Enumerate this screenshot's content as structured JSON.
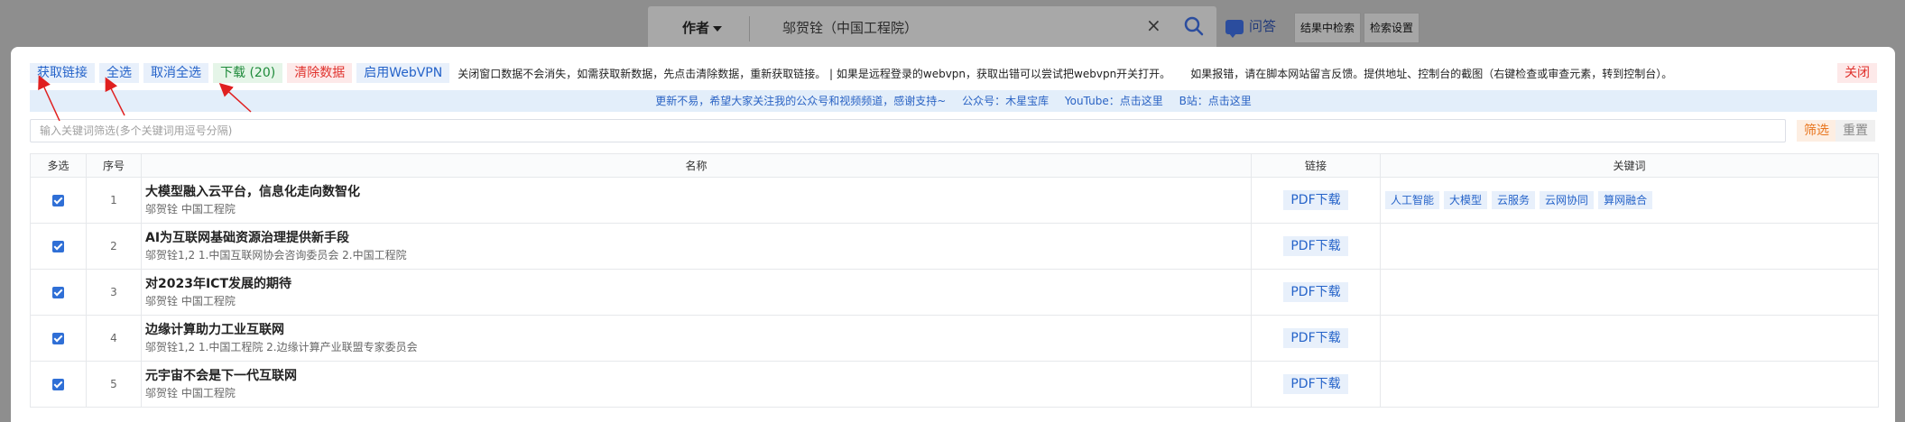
{
  "background": {
    "search_field_label": "作者",
    "search_query": "邬贺铨（中国工程院）",
    "qa_label": "问答",
    "buttons": [
      "结果中检索",
      "检索设置"
    ],
    "clear_glyph": "×"
  },
  "toolbar": {
    "get_links": "获取链接",
    "select_all": "全选",
    "deselect_all": "取消全选",
    "download": "下载 (20)",
    "clear_data": "清除数据",
    "enable_webvpn": "启用WebVPN",
    "note1": "关闭窗口数据不会消失，如需获取新数据，先点击清除数据，重新获取链接。 | 如果是远程登录的webvpn，获取出错可以尝试把webvpn开关打开。",
    "note2": "如果报错，请在脚本网站留言反馈。提供地址、控制台的截图（右键检查或审查元素，转到控制台）。",
    "close": "关闭"
  },
  "promo": {
    "text1": "更新不易，希望大家关注我的公众号和视频频道，感谢支持~",
    "text2": "公众号：木星宝库",
    "text3": "YouTube：点击这里",
    "text4": "B站：点击这里"
  },
  "filter": {
    "placeholder": "输入关键词筛选(多个关键词用逗号分隔)",
    "filter_label": "筛选",
    "reset_label": "重置"
  },
  "table": {
    "headers": {
      "select": "多选",
      "index": "序号",
      "name": "名称",
      "link": "链接",
      "keywords": "关键词"
    },
    "pdf_label": "PDF下载",
    "rows": [
      {
        "index": "1",
        "title": "大模型融入云平台，信息化走向数智化",
        "authors": "邬贺铨 中国工程院",
        "keywords": [
          "人工智能",
          "大模型",
          "云服务",
          "云网协同",
          "算网融合"
        ]
      },
      {
        "index": "2",
        "title": "AI为互联网基础资源治理提供新手段",
        "authors": "邬贺铨1,2 1.中国互联网协会咨询委员会 2.中国工程院",
        "keywords": []
      },
      {
        "index": "3",
        "title": "对2023年ICT发展的期待",
        "authors": "邬贺铨 中国工程院",
        "keywords": []
      },
      {
        "index": "4",
        "title": "边缘计算助力工业互联网",
        "authors": "邬贺铨1,2 1.中国工程院 2.边缘计算产业联盟专家委员会",
        "keywords": []
      },
      {
        "index": "5",
        "title": "元宇宙不会是下一代互联网",
        "authors": "邬贺铨 中国工程院",
        "keywords": []
      }
    ]
  },
  "colors": {
    "accent_blue": "#2563c9",
    "download_green": "#1e8a3a",
    "danger_red": "#e0322d",
    "filter_orange": "#e8741c",
    "annotation_red": "#e02020"
  }
}
